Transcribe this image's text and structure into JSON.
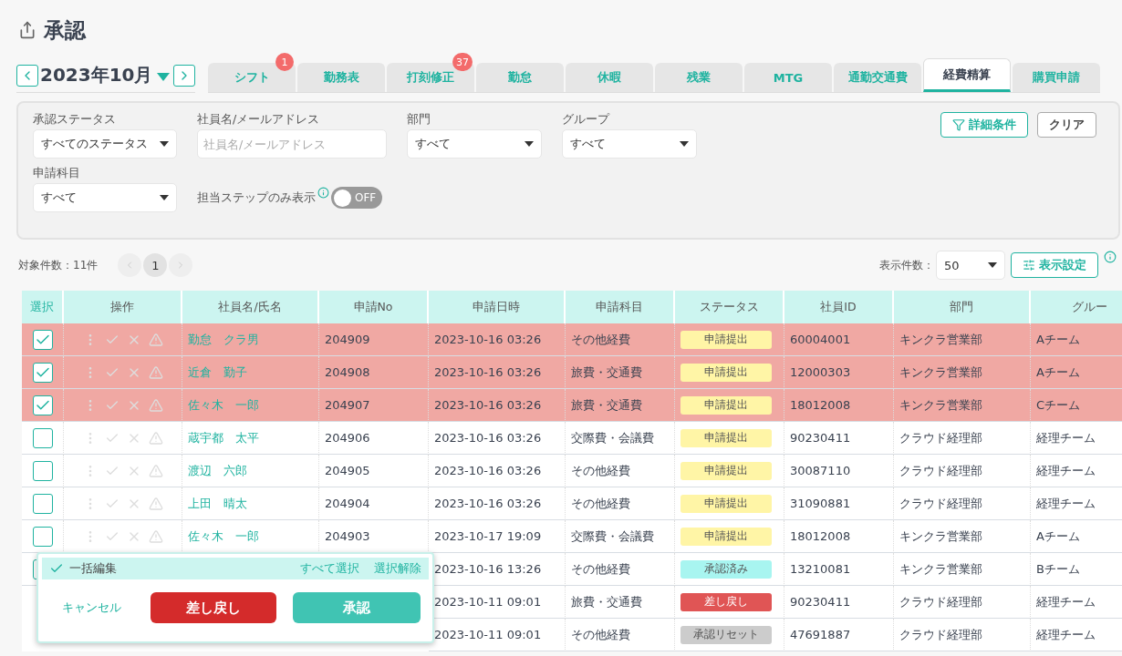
{
  "page": {
    "title": "承認"
  },
  "month": {
    "label": "2023年10月"
  },
  "tabs": [
    {
      "label": "シフト",
      "selected": false,
      "badge": "1"
    },
    {
      "label": "勤務表",
      "selected": false
    },
    {
      "label": "打刻修正",
      "selected": false,
      "badge": "37"
    },
    {
      "label": "勤怠",
      "selected": false
    },
    {
      "label": "休暇",
      "selected": false
    },
    {
      "label": "残業",
      "selected": false
    },
    {
      "label": "MTG",
      "selected": false
    },
    {
      "label": "通勤交通費",
      "selected": false
    },
    {
      "label": "経費精算",
      "selected": true
    },
    {
      "label": "購買申請",
      "selected": false
    }
  ],
  "filters": {
    "fields": [
      {
        "kind": "select",
        "label": "承認ステータス",
        "value": "すべてのステータス"
      },
      {
        "kind": "text",
        "label": "社員名/メールアドレス",
        "placeholder": "社員名/メールアドレス"
      },
      {
        "kind": "select",
        "label": "部門",
        "value": "すべて"
      },
      {
        "kind": "select",
        "label": "グループ",
        "value": "すべて"
      }
    ],
    "category": {
      "label": "申請科目",
      "value": "すべて"
    },
    "toggle": {
      "label": "担当ステップのみ表示",
      "on": false,
      "state_text": "OFF"
    },
    "buttons": [
      "詳細条件",
      "クリア"
    ]
  },
  "results": {
    "count": "対象件数：11件",
    "page": "1",
    "per_page_label": "表示件数：",
    "per_page": "50",
    "settings_button": "表示設定"
  },
  "table": {
    "columns": [
      "選択",
      "操作",
      "社員名/氏名",
      "申請No",
      "申請日時",
      "申請科目",
      "ステータス",
      "社員ID",
      "部門",
      "グルー"
    ],
    "rows": [
      {
        "checked": true,
        "name": "勤怠　クラ男",
        "no": "204909",
        "date": "2023-10-16 03:26",
        "category": "その他経費",
        "status": {
          "label": "申請提出",
          "color": "#fff5a6"
        },
        "employee_id": "60004001",
        "department": "キンクラ営業部",
        "group": "Aチーム"
      },
      {
        "checked": true,
        "name": "近倉　勤子",
        "no": "204908",
        "date": "2023-10-16 03:26",
        "category": "旅費・交通費",
        "status": {
          "label": "申請提出",
          "color": "#fff5a6"
        },
        "employee_id": "12000303",
        "department": "キンクラ営業部",
        "group": "Aチーム"
      },
      {
        "checked": true,
        "name": "佐々木　一郎",
        "no": "204907",
        "date": "2023-10-16 03:26",
        "category": "旅費・交通費",
        "status": {
          "label": "申請提出",
          "color": "#fff5a6"
        },
        "employee_id": "18012008",
        "department": "キンクラ営業部",
        "group": "Cチーム"
      },
      {
        "checked": false,
        "name": "蔵宇都　太平",
        "no": "204906",
        "date": "2023-10-16 03:26",
        "category": "交際費・会議費",
        "status": {
          "label": "申請提出",
          "color": "#fff5a6"
        },
        "employee_id": "90230411",
        "department": "クラウド経理部",
        "group": "経理チーム"
      },
      {
        "checked": false,
        "name": "渡辺　六郎",
        "no": "204905",
        "date": "2023-10-16 03:26",
        "category": "その他経費",
        "status": {
          "label": "申請提出",
          "color": "#fff5a6"
        },
        "employee_id": "30087110",
        "department": "クラウド経理部",
        "group": "経理チーム"
      },
      {
        "checked": false,
        "name": "上田　晴太",
        "no": "204904",
        "date": "2023-10-16 03:26",
        "category": "その他経費",
        "status": {
          "label": "申請提出",
          "color": "#fff5a6"
        },
        "employee_id": "31090881",
        "department": "クラウド経理部",
        "group": "経理チーム"
      },
      {
        "checked": false,
        "name": "佐々木　一郎",
        "no": "204903",
        "date": "2023-10-17 19:09",
        "category": "交際費・会議費",
        "status": {
          "label": "申請提出",
          "color": "#fff5a6"
        },
        "employee_id": "18012008",
        "department": "キンクラ営業部",
        "group": "Aチーム"
      },
      {
        "checked": false,
        "date": "2023-10-16 13:26",
        "category": "その他経費",
        "status": {
          "label": "承認済み",
          "color": "#a8f5f0"
        },
        "employee_id": "13210081",
        "department": "キンクラ営業部",
        "group": "Bチーム"
      },
      {
        "date": "2023-10-11 09:01",
        "category": "旅費・交通費",
        "status": {
          "label": "差し戻し",
          "color": "#e05555"
        },
        "employee_id": "90230411",
        "department": "クラウド経理部",
        "group": "経理チーム"
      },
      {
        "date": "2023-10-11 09:01",
        "category": "その他経費",
        "status": {
          "label": "承認リセット",
          "color": "#cccccc"
        },
        "employee_id": "47691887",
        "department": "クラウド経理部",
        "group": "経理チーム"
      }
    ]
  },
  "bulk_edit": {
    "title": "一括編集",
    "links": [
      "すべて選択",
      "選択解除"
    ],
    "cancel": "キャンセル",
    "reject": "差し戻し",
    "approve": "承認"
  }
}
